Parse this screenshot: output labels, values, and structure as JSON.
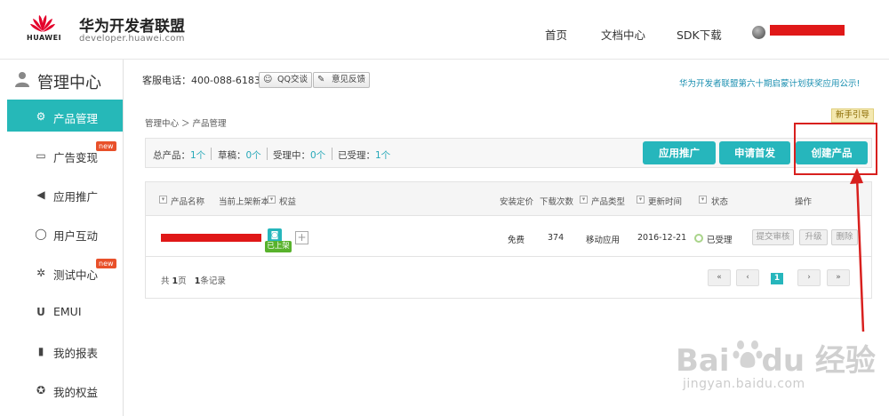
{
  "header": {
    "logo_text": "HUAWEI",
    "brand_title": "华为开发者联盟",
    "brand_url": "developer.huawei.com",
    "nav": [
      "首页",
      "文档中心",
      "SDK下载"
    ]
  },
  "sidebar": {
    "title": "管理中心",
    "items": [
      {
        "label": "产品管理",
        "icon": "gear-icon",
        "active": true
      },
      {
        "label": "广告变现",
        "icon": "monitor-icon",
        "badge": "new"
      },
      {
        "label": "应用推广",
        "icon": "megaphone-icon"
      },
      {
        "label": "用户互动",
        "icon": "chat-icon"
      },
      {
        "label": "测试中心",
        "icon": "test-icon",
        "badge": "new"
      },
      {
        "label": "EMUI",
        "icon": "emui-icon"
      },
      {
        "label": "我的报表",
        "icon": "chart-icon"
      },
      {
        "label": "我的权益",
        "icon": "star-icon"
      }
    ]
  },
  "toolbar": {
    "hotline": "客服电话：400-088-6183",
    "qq_label": "QQ交谈",
    "feedback_label": "意见反馈",
    "notice": "华为开发者联盟第六十期启蒙计划获奖应用公示!"
  },
  "breadcrumb": "管理中心 ＞ 产品管理",
  "guide_label": "新手引导",
  "stats": {
    "total_label": "总产品：",
    "total": "1个",
    "draft_label": "草稿：",
    "draft": "0个",
    "pending_label": "受理中：",
    "pending": "0个",
    "accepted_label": "已受理：",
    "accepted": "1个"
  },
  "actions": {
    "promote": "应用推广",
    "first_launch": "申请首发",
    "create": "创建产品"
  },
  "table": {
    "headers": [
      "产品名称",
      "当前上架新本",
      "权益",
      "安装定价",
      "下载次数",
      "产品类型",
      "更新时间",
      "状态",
      "操作"
    ],
    "row": {
      "status_tag": "已上架",
      "price": "免费",
      "downloads": "374",
      "type": "移动应用",
      "updated": "2016-12-21",
      "state": "已受理",
      "ops": [
        "提交审核",
        "升级",
        "删除"
      ]
    },
    "pager": {
      "total_pages_pre": "共",
      "total_pages": "1",
      "total_pages_post": "页",
      "records": "1",
      "records_post": "条记录",
      "first": "«",
      "prev": "‹",
      "current": "1",
      "next": "›",
      "last": "»"
    }
  },
  "watermark": {
    "text_left": "Bai",
    "text_right": "du 经验",
    "sub": "jingyan.baidu.com"
  },
  "colors": {
    "accent": "#26b6bc",
    "highlight": "#d8201e",
    "badge": "#e8502a",
    "success": "#58b22c"
  }
}
